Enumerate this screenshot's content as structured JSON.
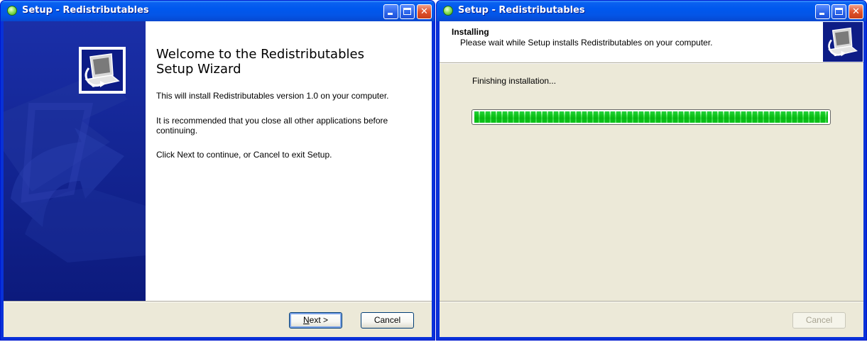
{
  "left_window": {
    "title": "Setup - Redistributables",
    "welcome_title": "Welcome to the Redistributables Setup Wizard",
    "paragraphs": [
      "This will install Redistributables version 1.0 on your computer.",
      "It is recommended that you close all other applications before continuing.",
      "Click Next to continue, or Cancel to exit Setup."
    ],
    "next_label_mnemonic": "N",
    "next_label_rest": "ext >",
    "cancel_label": "Cancel"
  },
  "right_window": {
    "title": "Setup - Redistributables",
    "header_title": "Installing",
    "header_subtitle": "Please wait while Setup installs Redistributables on your computer.",
    "status": "Finishing installation...",
    "progress_fraction": 1.0,
    "cancel_label": "Cancel",
    "cancel_enabled": false
  },
  "icons": [
    "app-status-icon",
    "minimize-icon",
    "maximize-icon",
    "close-icon",
    "setup-computer-icon"
  ],
  "colors": {
    "titlebar": "#0058ee",
    "side_panel": "#0d1c86",
    "dialog_bg": "#ece9d8",
    "close_button": "#e0532d",
    "progress_green": "#2fdc4f"
  }
}
